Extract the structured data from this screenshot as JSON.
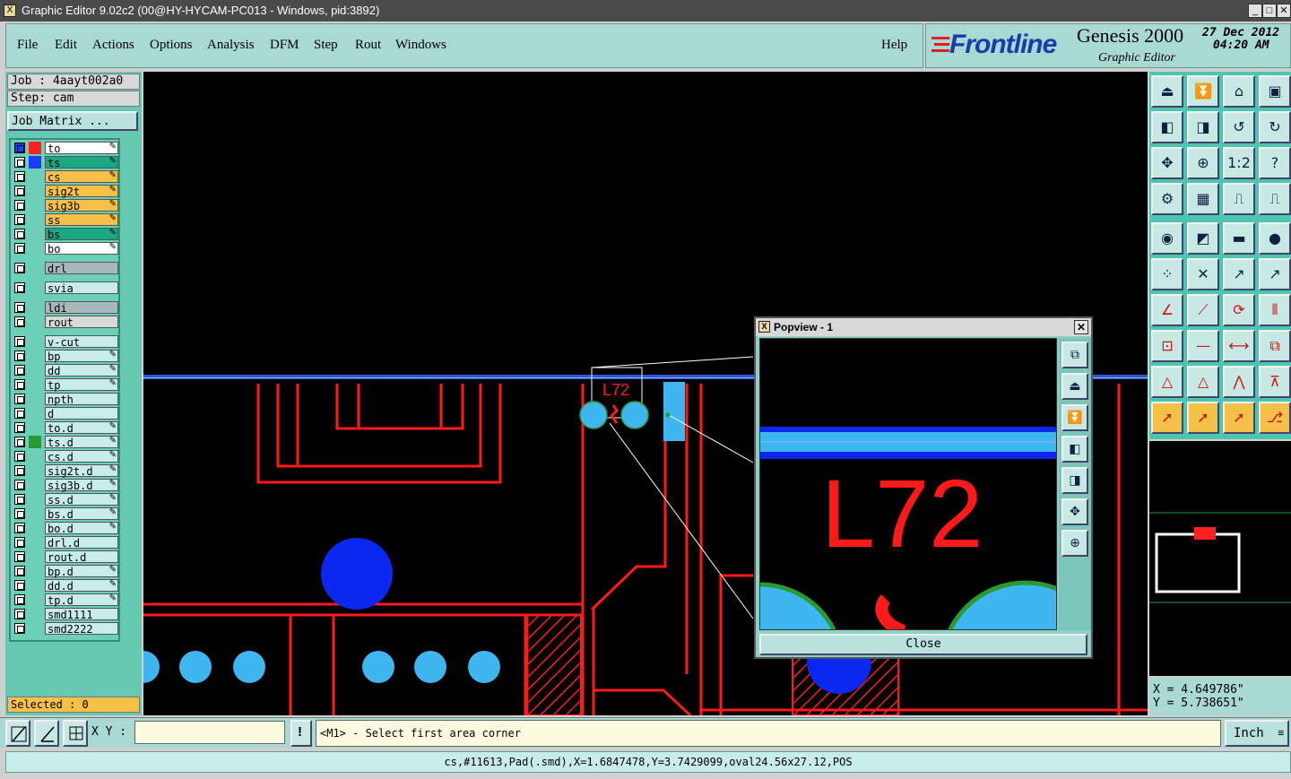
{
  "window": {
    "title": "Graphic Editor 9.02c2 (00@HY-HYCAM-PC013 - Windows, pid:3892)",
    "icon": "x-icon",
    "controls": [
      "_",
      "□",
      "✕"
    ]
  },
  "menu": {
    "items": [
      "File",
      "Edit",
      "Actions",
      "Options",
      "Analysis",
      "DFM",
      "Step",
      "Rout",
      "Windows"
    ],
    "help": "Help"
  },
  "brand": {
    "logo": "Frontline",
    "product": "Genesis 2000",
    "subtitle": "Graphic Editor",
    "date": "27 Dec 2012",
    "time": "04:20 AM"
  },
  "job": {
    "job_label": "Job : 4aayt002a0",
    "step_label": "Step: cam",
    "matrix_button": "Job Matrix ..."
  },
  "layers": [
    {
      "name": "to",
      "color": "#ffffff",
      "swatch": "#ff2020",
      "editable": true
    },
    {
      "name": "ts",
      "color": "#19a884",
      "swatch": "#1a3cff",
      "editable": true
    },
    {
      "name": "cs",
      "color": "#f4c048",
      "swatch": "",
      "editable": true
    },
    {
      "name": "sig2t",
      "color": "#f4c048",
      "swatch": "",
      "editable": true
    },
    {
      "name": "sig3b",
      "color": "#f4c048",
      "swatch": "",
      "editable": true
    },
    {
      "name": "ss",
      "color": "#f4c048",
      "swatch": "",
      "editable": true
    },
    {
      "name": "bs",
      "color": "#19a884",
      "swatch": "",
      "editable": true
    },
    {
      "name": "bo",
      "color": "#ffffff",
      "swatch": "",
      "editable": true
    },
    {
      "name": "drl",
      "color": "#a8b8bc",
      "swatch": "",
      "editable": false
    },
    {
      "name": "svia",
      "color": "#c8ece8",
      "swatch": "",
      "editable": false
    },
    {
      "name": "ldi",
      "color": "#a8b8bc",
      "swatch": "",
      "editable": false
    },
    {
      "name": "rout",
      "color": "#d8d8d8",
      "swatch": "",
      "editable": false
    },
    {
      "name": "v-cut",
      "color": "#c8ece8",
      "swatch": "",
      "editable": false
    },
    {
      "name": "bp",
      "color": "#c8ece8",
      "swatch": "",
      "editable": true
    },
    {
      "name": "dd",
      "color": "#c8ece8",
      "swatch": "",
      "editable": true
    },
    {
      "name": "tp",
      "color": "#c8ece8",
      "swatch": "",
      "editable": true
    },
    {
      "name": "npth",
      "color": "#c8ece8",
      "swatch": "",
      "editable": false
    },
    {
      "name": "d",
      "color": "#c8ece8",
      "swatch": "",
      "editable": false
    },
    {
      "name": "to.d",
      "color": "#c8ece8",
      "swatch": "",
      "editable": true
    },
    {
      "name": "ts.d",
      "color": "#c8ece8",
      "swatch": "#2a9a30",
      "editable": true
    },
    {
      "name": "cs.d",
      "color": "#c8ece8",
      "swatch": "",
      "editable": true
    },
    {
      "name": "sig2t.d",
      "color": "#c8ece8",
      "swatch": "",
      "editable": true
    },
    {
      "name": "sig3b.d",
      "color": "#c8ece8",
      "swatch": "",
      "editable": true
    },
    {
      "name": "ss.d",
      "color": "#c8ece8",
      "swatch": "",
      "editable": true
    },
    {
      "name": "bs.d",
      "color": "#c8ece8",
      "swatch": "",
      "editable": true
    },
    {
      "name": "bo.d",
      "color": "#c8ece8",
      "swatch": "",
      "editable": true
    },
    {
      "name": "drl.d",
      "color": "#c8ece8",
      "swatch": "",
      "editable": false
    },
    {
      "name": "rout.d",
      "color": "#c8ece8",
      "swatch": "",
      "editable": false
    },
    {
      "name": "bp.d",
      "color": "#c8ece8",
      "swatch": "",
      "editable": true
    },
    {
      "name": "dd.d",
      "color": "#c8ece8",
      "swatch": "",
      "editable": true
    },
    {
      "name": "tp.d",
      "color": "#c8ece8",
      "swatch": "",
      "editable": true
    },
    {
      "name": "smd1111",
      "color": "#c8ece8",
      "swatch": "",
      "editable": false
    },
    {
      "name": "smd2222",
      "color": "#c8ece8",
      "swatch": "",
      "editable": false
    }
  ],
  "selected": "Selected : 0",
  "canvas": {
    "label_text": "L72"
  },
  "popview": {
    "title": "Popview - 1",
    "label_text": "L72",
    "close": "Close"
  },
  "coords": {
    "x": "X = 4.649786\"",
    "y": "Y = 5.738651\""
  },
  "bottom": {
    "xy_label": "X Y :",
    "xy_value": "",
    "prompt": "<M1> - Select first area corner",
    "units": "Inch"
  },
  "status": "cs,#11613,Pad(.smd),X=1.6847478,Y=3.7429099,oval24.56x27.12,POS"
}
